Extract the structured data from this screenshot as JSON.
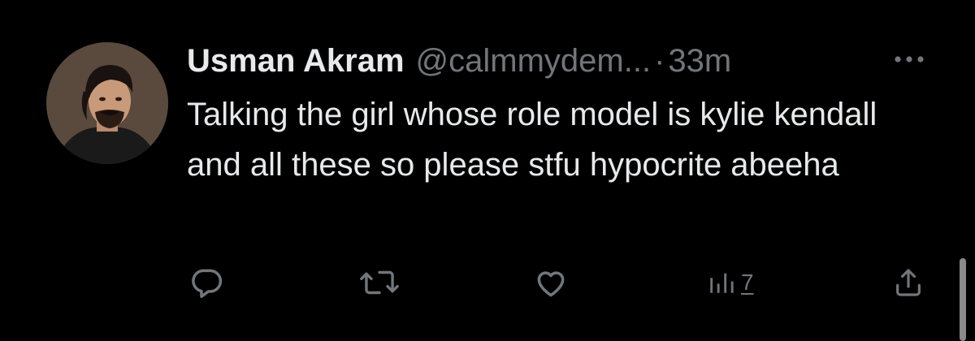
{
  "tweet": {
    "display_name": "Usman Akram",
    "handle": "@calmmydem...",
    "separator": "·",
    "timestamp": "33m",
    "text": "Talking the girl whose role model is kylie kendall and all these so please stfu hypocrite abeeha",
    "avatar_icon": "user-avatar-photo"
  },
  "actions": {
    "reply_icon": "reply-icon",
    "retweet_icon": "retweet-icon",
    "like_icon": "heart-icon",
    "views_icon": "analytics-icon",
    "views_count": "7",
    "share_icon": "share-icon"
  },
  "colors": {
    "background": "#000000",
    "primary_text": "#e7e9ea",
    "secondary_text": "#71767b"
  }
}
